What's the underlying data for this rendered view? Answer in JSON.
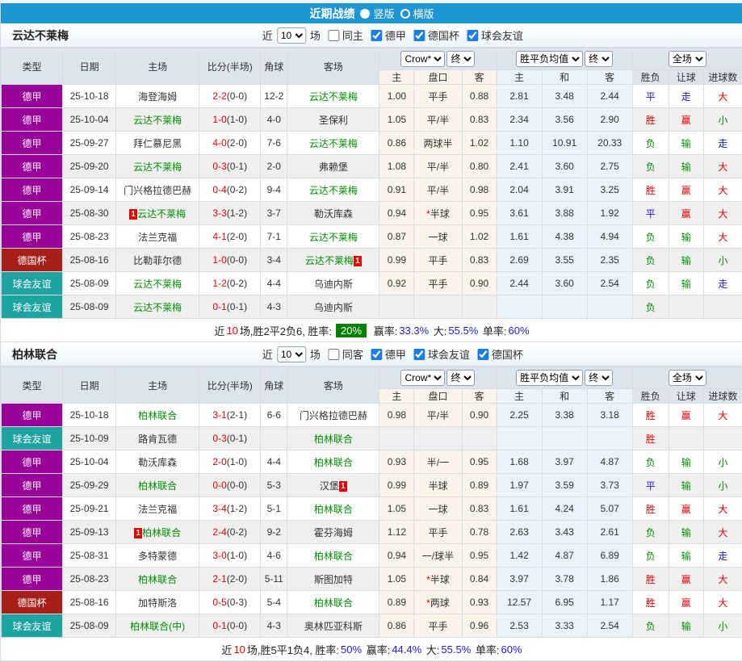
{
  "titlebar": {
    "title": "近期战绩",
    "radio_selected": "竖版",
    "radio_unselected": "横版"
  },
  "badge_text": "1",
  "table_header": {
    "cols": [
      "类型",
      "日期",
      "主场",
      "比分(半场)",
      "角球",
      "客场"
    ],
    "crow_select": "Crow*",
    "final_select": "终",
    "mean_select": "胜平负均值",
    "scope_select": "全场",
    "sub": [
      "主",
      "盘口",
      "客",
      "主",
      "和",
      "客",
      "胜负",
      "让球",
      "进球数"
    ]
  },
  "league_colors": {
    "德甲": "#990099",
    "德国杯": "#a62019",
    "球会友谊": "#1ea3a3"
  },
  "result_colors": {
    "胜": "#e60000",
    "赢": "#e60000",
    "大": "#e60000",
    "平": "#1515cc",
    "走": "#1515cc",
    "负": "#008f00",
    "输": "#008f00",
    "小": "#008f00"
  },
  "sections": [
    {
      "team": "云达不莱梅",
      "filter": {
        "near": "近",
        "count": "10",
        "games": "场",
        "same_label": "同主",
        "same_checked": false,
        "leagues": [
          {
            "label": "德甲",
            "checked": true
          },
          {
            "label": "德国杯",
            "checked": true
          },
          {
            "label": "球会友谊",
            "checked": true
          }
        ]
      },
      "rows": [
        {
          "league": "德甲",
          "date": "25-10-18",
          "home": "海登海姆",
          "home_green": false,
          "home_badge": "",
          "score": "2-2",
          "half": "(0-0)",
          "corner": "12-2",
          "away": "云达不莱梅",
          "away_green": true,
          "away_badge": "",
          "odds": [
            "1.00",
            "平手",
            "0.88"
          ],
          "mean": [
            "2.81",
            "3.48",
            "2.44"
          ],
          "results": [
            "平",
            "走",
            "大"
          ]
        },
        {
          "league": "德甲",
          "date": "25-10-04",
          "home": "云达不莱梅",
          "home_green": true,
          "home_badge": "",
          "score": "1-0",
          "half": "(1-0)",
          "corner": "4-0",
          "away": "圣保利",
          "away_green": false,
          "away_badge": "",
          "odds": [
            "1.05",
            "平/半",
            "0.83"
          ],
          "mean": [
            "2.34",
            "3.56",
            "2.90"
          ],
          "results": [
            "胜",
            "赢",
            "小"
          ]
        },
        {
          "league": "德甲",
          "date": "25-09-27",
          "home": "拜仁慕尼黑",
          "home_green": false,
          "home_badge": "",
          "score": "4-0",
          "half": "(2-0)",
          "corner": "7-6",
          "away": "云达不莱梅",
          "away_green": true,
          "away_badge": "",
          "odds": [
            "0.86",
            "两球半",
            "1.02"
          ],
          "mean": [
            "1.10",
            "10.91",
            "20.33"
          ],
          "results": [
            "负",
            "输",
            "走"
          ]
        },
        {
          "league": "德甲",
          "date": "25-09-20",
          "home": "云达不莱梅",
          "home_green": true,
          "home_badge": "",
          "score": "0-3",
          "half": "(0-1)",
          "corner": "2-0",
          "away": "弗赖堡",
          "away_green": false,
          "away_badge": "",
          "odds": [
            "1.08",
            "平/半",
            "0.80"
          ],
          "mean": [
            "2.41",
            "3.60",
            "2.75"
          ],
          "results": [
            "负",
            "输",
            "大"
          ]
        },
        {
          "league": "德甲",
          "date": "25-09-14",
          "home": "门兴格拉德巴赫",
          "home_green": false,
          "home_badge": "",
          "score": "0-4",
          "half": "(0-2)",
          "corner": "9-4",
          "away": "云达不莱梅",
          "away_green": true,
          "away_badge": "",
          "odds": [
            "0.91",
            "平/半",
            "0.98"
          ],
          "mean": [
            "2.04",
            "3.91",
            "3.25"
          ],
          "results": [
            "胜",
            "赢",
            "大"
          ]
        },
        {
          "league": "德甲",
          "date": "25-08-30",
          "home": "云达不莱梅",
          "home_green": true,
          "home_badge": "before",
          "score": "3-3",
          "half": "(1-2)",
          "corner": "3-7",
          "away": "勒沃库森",
          "away_green": false,
          "away_badge": "",
          "odds": [
            "0.94",
            "*半球",
            "0.95"
          ],
          "mean": [
            "3.61",
            "3.88",
            "1.92"
          ],
          "results": [
            "平",
            "赢",
            "大"
          ]
        },
        {
          "league": "德甲",
          "date": "25-08-23",
          "home": "法兰克福",
          "home_green": false,
          "home_badge": "",
          "score": "4-1",
          "half": "(2-0)",
          "corner": "7-1",
          "away": "云达不莱梅",
          "away_green": true,
          "away_badge": "",
          "odds": [
            "0.87",
            "一球",
            "1.02"
          ],
          "mean": [
            "1.61",
            "4.38",
            "4.94"
          ],
          "results": [
            "负",
            "输",
            "大"
          ]
        },
        {
          "league": "德国杯",
          "date": "25-08-16",
          "home": "比勒菲尔德",
          "home_green": false,
          "home_badge": "",
          "score": "1-0",
          "half": "(0-0)",
          "corner": "3-4",
          "away": "云达不莱梅",
          "away_green": true,
          "away_badge": "after",
          "odds": [
            "0.99",
            "平手",
            "0.83"
          ],
          "mean": [
            "2.69",
            "3.55",
            "2.35"
          ],
          "results": [
            "负",
            "输",
            "小"
          ]
        },
        {
          "league": "球会友谊",
          "date": "25-08-09",
          "home": "云达不莱梅",
          "home_green": true,
          "home_badge": "",
          "score": "1-2",
          "half": "(0-2)",
          "corner": "4-4",
          "away": "乌迪内斯",
          "away_green": false,
          "away_badge": "",
          "odds": [
            "0.92",
            "平手",
            "0.90"
          ],
          "mean": [
            "2.44",
            "3.60",
            "2.54"
          ],
          "results": [
            "负",
            "输",
            "走"
          ]
        },
        {
          "league": "球会友谊",
          "date": "25-08-09",
          "home": "云达不莱梅",
          "home_green": true,
          "home_badge": "",
          "score": "0-1",
          "half": "(0-1)",
          "corner": "4-3",
          "away": "乌迪内斯",
          "away_green": false,
          "away_badge": "",
          "odds": [
            "",
            "",
            ""
          ],
          "mean": [
            "",
            "",
            ""
          ],
          "results": [
            "负",
            "",
            ""
          ]
        }
      ],
      "summary": {
        "near": "近",
        "count": "10",
        "text": "场,胜2平2负6, 胜率:",
        "rate": "20%",
        "rate_badge": true,
        "win_label": "赢率:",
        "win": "33.3%",
        "big_label": "大:",
        "big": "55.5%",
        "single_label": "单率:",
        "single": "60%"
      }
    },
    {
      "team": "柏林联合",
      "filter": {
        "near": "近",
        "count": "10",
        "games": "场",
        "same_label": "同客",
        "same_checked": false,
        "leagues": [
          {
            "label": "德甲",
            "checked": true
          },
          {
            "label": "球会友谊",
            "checked": true
          },
          {
            "label": "德国杯",
            "checked": true
          }
        ]
      },
      "rows": [
        {
          "league": "德甲",
          "date": "25-10-18",
          "home": "柏林联合",
          "home_green": true,
          "home_badge": "",
          "score": "3-1",
          "half": "(2-1)",
          "corner": "6-6",
          "away": "门兴格拉德巴赫",
          "away_green": false,
          "away_badge": "",
          "odds": [
            "0.98",
            "平/半",
            "0.90"
          ],
          "mean": [
            "2.25",
            "3.38",
            "3.18"
          ],
          "results": [
            "胜",
            "赢",
            "大"
          ]
        },
        {
          "league": "球会友谊",
          "date": "25-10-09",
          "home": "路肯瓦德",
          "home_green": false,
          "home_badge": "",
          "score": "0-3",
          "half": "(0-1)",
          "corner": "",
          "away": "柏林联合",
          "away_green": true,
          "away_badge": "",
          "odds": [
            "",
            "",
            ""
          ],
          "mean": [
            "",
            "",
            ""
          ],
          "results": [
            "胜",
            "",
            ""
          ]
        },
        {
          "league": "德甲",
          "date": "25-10-04",
          "home": "勒沃库森",
          "home_green": false,
          "home_badge": "",
          "score": "2-0",
          "half": "(1-0)",
          "corner": "4-4",
          "away": "柏林联合",
          "away_green": true,
          "away_badge": "",
          "odds": [
            "0.93",
            "半/一",
            "0.95"
          ],
          "mean": [
            "1.68",
            "3.97",
            "4.87"
          ],
          "results": [
            "负",
            "输",
            "小"
          ]
        },
        {
          "league": "德甲",
          "date": "25-09-29",
          "home": "柏林联合",
          "home_green": true,
          "home_badge": "",
          "score": "0-0",
          "half": "(0-0)",
          "corner": "5-3",
          "away": "汉堡",
          "away_green": false,
          "away_badge": "after",
          "odds": [
            "0.99",
            "半球",
            "0.89"
          ],
          "mean": [
            "1.97",
            "3.59",
            "3.73"
          ],
          "results": [
            "平",
            "输",
            "小"
          ]
        },
        {
          "league": "德甲",
          "date": "25-09-21",
          "home": "法兰克福",
          "home_green": false,
          "home_badge": "",
          "score": "3-4",
          "half": "(1-2)",
          "corner": "5-1",
          "away": "柏林联合",
          "away_green": true,
          "away_badge": "",
          "odds": [
            "1.05",
            "一球",
            "0.83"
          ],
          "mean": [
            "1.61",
            "4.24",
            "5.07"
          ],
          "results": [
            "胜",
            "赢",
            "大"
          ]
        },
        {
          "league": "德甲",
          "date": "25-09-13",
          "home": "柏林联合",
          "home_green": true,
          "home_badge": "before",
          "score": "2-4",
          "half": "(0-2)",
          "corner": "9-2",
          "away": "霍芬海姆",
          "away_green": false,
          "away_badge": "",
          "odds": [
            "1.12",
            "平手",
            "0.78"
          ],
          "mean": [
            "2.63",
            "3.43",
            "2.61"
          ],
          "results": [
            "负",
            "输",
            "大"
          ]
        },
        {
          "league": "德甲",
          "date": "25-08-31",
          "home": "多特蒙德",
          "home_green": false,
          "home_badge": "",
          "score": "3-0",
          "half": "(1-0)",
          "corner": "4-6",
          "away": "柏林联合",
          "away_green": true,
          "away_badge": "",
          "odds": [
            "0.94",
            "一/球半",
            "0.95"
          ],
          "mean": [
            "1.42",
            "4.87",
            "6.89"
          ],
          "results": [
            "负",
            "输",
            "走"
          ]
        },
        {
          "league": "德甲",
          "date": "25-08-23",
          "home": "柏林联合",
          "home_green": true,
          "home_badge": "",
          "score": "2-1",
          "half": "(2-0)",
          "corner": "5-11",
          "away": "斯图加特",
          "away_green": false,
          "away_badge": "",
          "odds": [
            "1.05",
            "*半球",
            "0.84"
          ],
          "mean": [
            "3.97",
            "3.78",
            "1.86"
          ],
          "results": [
            "胜",
            "赢",
            "大"
          ]
        },
        {
          "league": "德国杯",
          "date": "25-08-16",
          "home": "加特斯洛",
          "home_green": false,
          "home_badge": "",
          "score": "0-5",
          "half": "(0-3)",
          "corner": "5-4",
          "away": "柏林联合",
          "away_green": true,
          "away_badge": "",
          "odds": [
            "0.89",
            "*两球",
            "0.93"
          ],
          "mean": [
            "12.57",
            "6.95",
            "1.17"
          ],
          "results": [
            "胜",
            "赢",
            "大"
          ]
        },
        {
          "league": "球会友谊",
          "date": "25-08-09",
          "home": "柏林联合(中)",
          "home_green": true,
          "home_badge": "",
          "score": "0-1",
          "half": "(0-0)",
          "corner": "4-3",
          "away": "奥林匹亚科斯",
          "away_green": false,
          "away_badge": "",
          "odds": [
            "0.86",
            "平手",
            "0.96"
          ],
          "mean": [
            "2.53",
            "3.33",
            "2.54"
          ],
          "results": [
            "负",
            "输",
            "小"
          ]
        }
      ],
      "summary": {
        "near": "近",
        "count": "10",
        "text": "场,胜5平1负4, 胜率:",
        "rate": "50%",
        "rate_badge": false,
        "win_label": "赢率:",
        "win": "44.4%",
        "big_label": "大:",
        "big": "55.5%",
        "single_label": "单率:",
        "single": "60%"
      }
    }
  ]
}
